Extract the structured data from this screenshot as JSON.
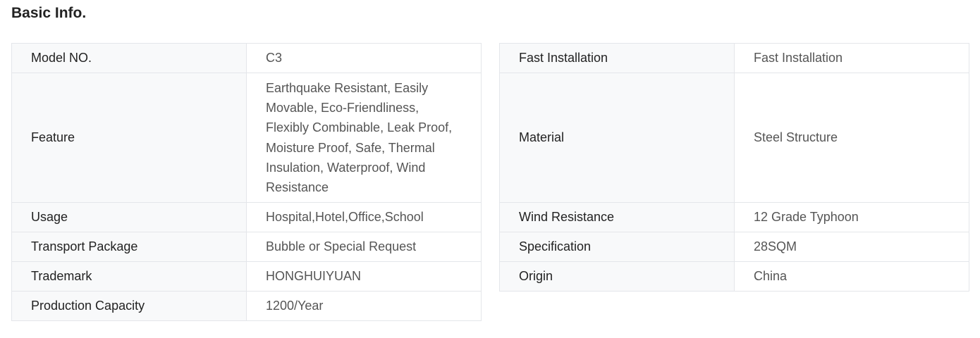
{
  "section": {
    "title": "Basic Info."
  },
  "left_table": [
    {
      "key": "Model NO.",
      "value": "C3"
    },
    {
      "key": "Feature",
      "value": "Earthquake Resistant, Easily Movable, Eco-Friendliness, Flexibly Combinable, Leak Proof, Moisture Proof, Safe, Thermal Insulation, Waterproof, Wind Resistance"
    },
    {
      "key": "Usage",
      "value": "Hospital,Hotel,Office,School"
    },
    {
      "key": "Transport Package",
      "value": "Bubble or Special Request"
    },
    {
      "key": "Trademark",
      "value": "HONGHUIYUAN"
    },
    {
      "key": "Production Capacity",
      "value": "1200/Year"
    }
  ],
  "right_table": [
    {
      "key": "Fast Installation",
      "value": "Fast Installation"
    },
    {
      "key": "Material",
      "value": "Steel Structure"
    },
    {
      "key": "Wind Resistance",
      "value": "12 Grade Typhoon"
    },
    {
      "key": "Specification",
      "value": "28SQM"
    },
    {
      "key": "Origin",
      "value": "China"
    }
  ],
  "colors": {
    "key_background": "#f8f9fa",
    "border": "#e4e6ea",
    "key_text": "#222222",
    "value_text": "#555555"
  }
}
